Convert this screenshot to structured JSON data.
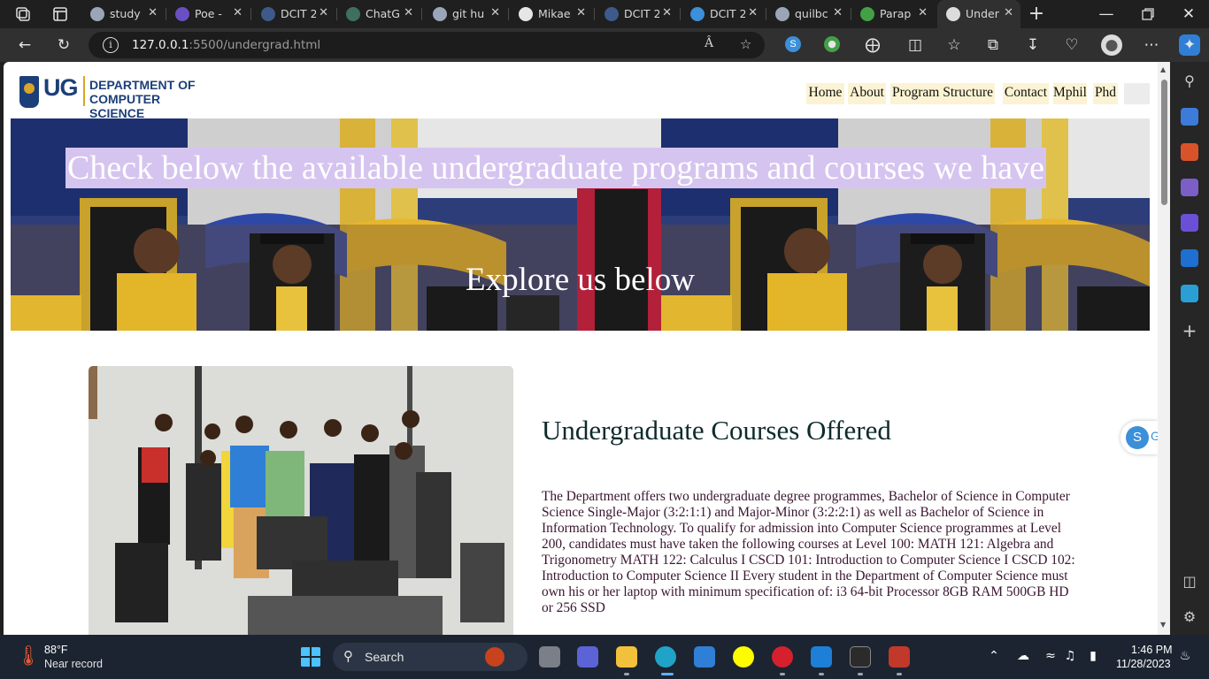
{
  "browser": {
    "tabs": [
      {
        "label": "study",
        "favicon": "search-icon",
        "color": "#9aa6b8"
      },
      {
        "label": "Poe -",
        "favicon": "poe-icon",
        "color": "#6a4fc2"
      },
      {
        "label": "DCIT 2",
        "favicon": "studocu-icon",
        "color": "#3d5a8a"
      },
      {
        "label": "ChatG",
        "favicon": "chatgpt-icon",
        "color": "#3f6f60"
      },
      {
        "label": "git hu",
        "favicon": "search-icon",
        "color": "#9aa6b8"
      },
      {
        "label": "Mikae",
        "favicon": "github-icon",
        "color": "#e6e6e6"
      },
      {
        "label": "DCIT 2",
        "favicon": "studocu-icon",
        "color": "#3d5a8a"
      },
      {
        "label": "DCIT 2",
        "favicon": "studocu-icon",
        "color": "#3c8fd9"
      },
      {
        "label": "quilbc",
        "favicon": "search-icon",
        "color": "#9aa6b8"
      },
      {
        "label": "Parap",
        "favicon": "quillbot-icon",
        "color": "#43a047"
      },
      {
        "label": "Under",
        "favicon": "document-icon",
        "color": "#dcdcdc"
      }
    ],
    "url_host": "127.0.0.1",
    "url_path": ":5500/undergrad.html"
  },
  "site": {
    "logo": {
      "ug": "UG",
      "dept_line1": "DEPARTMENT OF",
      "dept_line2": "COMPUTER SCIENCE"
    },
    "nav": [
      "Home",
      "About",
      "Program Structure",
      "Contact",
      "Mphil",
      "Phd"
    ],
    "hero": {
      "title": "Check below the available undergraduate programs and courses we have",
      "subtitle": "Explore us below"
    },
    "courses": {
      "title": "Undergraduate Courses Offered",
      "body": "The Department offers two undergraduate degree programmes, Bachelor of Science in Computer Science Single-Major (3:2:1:1) and Major-Minor (3:2:2:1) as well as Bachelor of Science in Information Technology. To qualify for admission into Computer Science programmes at Level 200, candidates must have taken the following courses at Level 100: MATH 121: Algebra and Trigonometry MATH 122: Calculus I CSCD 101: Introduction to Computer Science I CSCD 102: Introduction to Computer Science II Every student in the Department of Computer Science must own his or her laptop with minimum specification of: i3 64-bit Processor 8GB RAM 500GB HD or 256 SSD"
    },
    "float_chip": {
      "badge": "S",
      "label": "G"
    }
  },
  "taskbar": {
    "weather_temp": "88°F",
    "weather_desc": "Near record",
    "search_label": "Search",
    "time": "1:46 PM",
    "date": "11/28/2023"
  },
  "colors": {
    "nav_bg": "#fbf3d3",
    "hero_title_highlight": "#d5c4ef",
    "ug_blue": "#1c3f7a",
    "ug_gold": "#d9a52a"
  }
}
